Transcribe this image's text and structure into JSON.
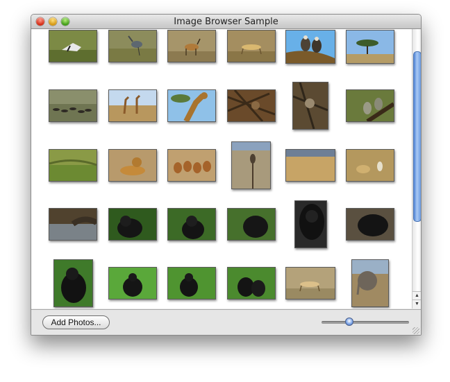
{
  "window": {
    "title": "Image Browser Sample"
  },
  "toolbar": {
    "add_photos_label": "Add Photos..."
  },
  "slider": {
    "zoom_level": 0.3
  },
  "photos": [
    "bird-grass",
    "heron",
    "gazelle",
    "cheetah",
    "vultures",
    "acacia-tree",
    "wildebeest-herd",
    "giraffes-plain",
    "giraffe-closeup",
    "baboons-tree",
    "monkey-tree",
    "monkeys-branch",
    "grassland",
    "lion-lying",
    "impalas",
    "eagle-perch",
    "savanna",
    "lions-grass",
    "hippo-water",
    "gorilla-1",
    "gorilla-2",
    "gorilla-3",
    "gorilla-4",
    "gorilla-5",
    "gorilla-6",
    "gorilla-7",
    "gorilla-8",
    "gorilla-9",
    "cheetah-walking",
    "elephant"
  ]
}
